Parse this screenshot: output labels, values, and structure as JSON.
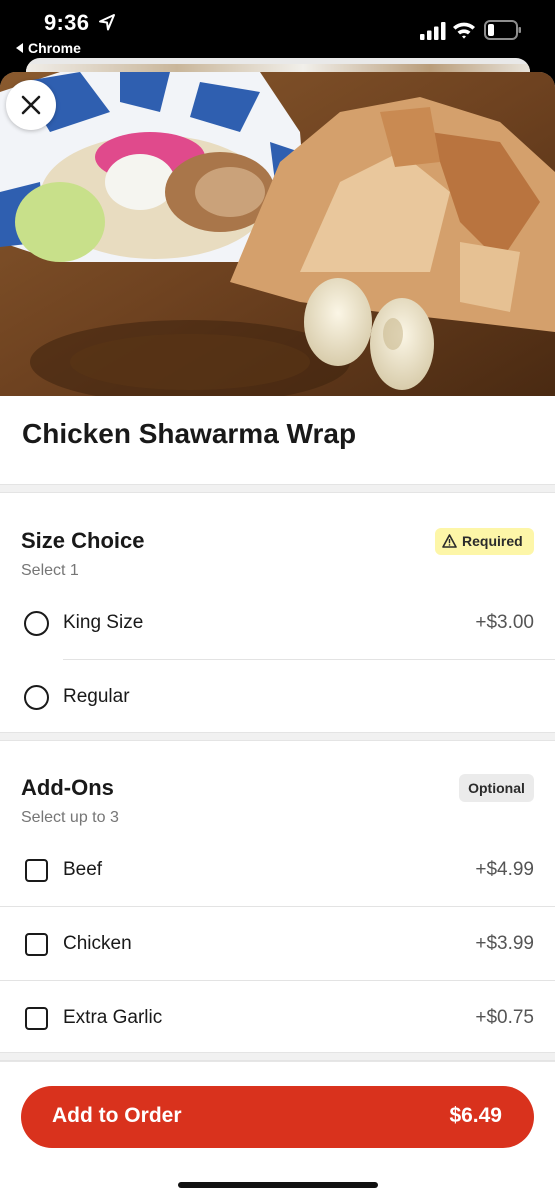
{
  "status_bar": {
    "time": "9:36",
    "back_app": "Chrome"
  },
  "item": {
    "title": "Chicken Shawarma Wrap",
    "image": "chicken-shawarma-wrap-photo"
  },
  "size_choice": {
    "title": "Size Choice",
    "subtitle": "Select 1",
    "badge": "Required",
    "options": [
      {
        "label": "King Size",
        "price": "+$3.00",
        "selected": false
      },
      {
        "label": "Regular",
        "price": "",
        "selected": false
      }
    ]
  },
  "add_ons": {
    "title": "Add-Ons",
    "subtitle": "Select up to 3",
    "badge": "Optional",
    "options": [
      {
        "label": "Beef",
        "price": "+$4.99",
        "checked": false
      },
      {
        "label": "Chicken",
        "price": "+$3.99",
        "checked": false
      },
      {
        "label": "Extra Garlic",
        "price": "+$0.75",
        "checked": false
      }
    ]
  },
  "footer": {
    "button_label": "Add to Order",
    "button_price": "$6.49"
  },
  "colors": {
    "accent": "#d9321d",
    "required_badge": "#fdf6a8",
    "optional_badge": "#ebebeb"
  },
  "icons": [
    "location-arrow-icon",
    "back-triangle-icon",
    "cellular-signal-icon",
    "wifi-icon",
    "battery-icon",
    "close-icon",
    "warning-icon"
  ]
}
